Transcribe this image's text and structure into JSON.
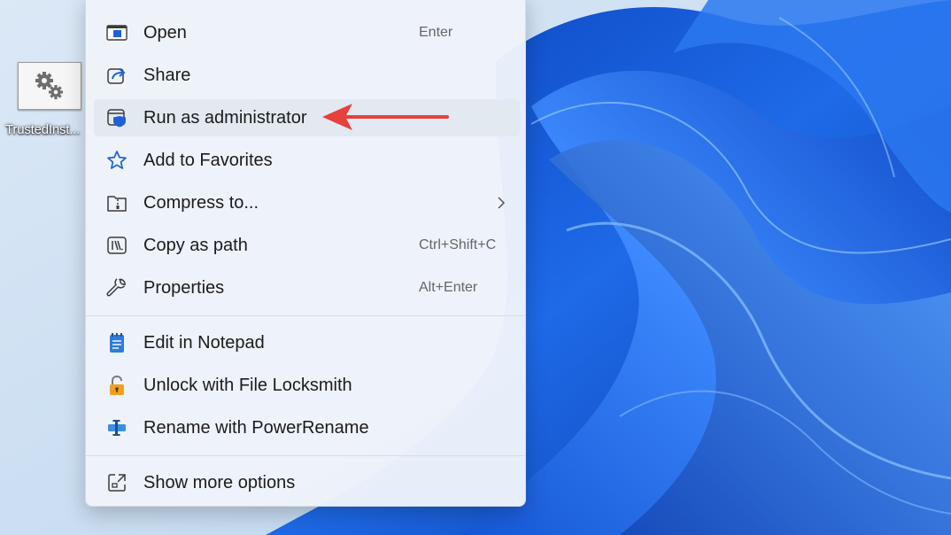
{
  "desktop": {
    "icon": {
      "name": "gear-file-icon",
      "label": "TrustedInst..."
    }
  },
  "context_menu": {
    "items": [
      {
        "label": "Open",
        "shortcut": "Enter",
        "icon": "open-window-icon"
      },
      {
        "label": "Share",
        "shortcut": "",
        "icon": "share-icon"
      },
      {
        "label": "Run as administrator",
        "shortcut": "",
        "icon": "shield-window-icon"
      },
      {
        "label": "Add to Favorites",
        "shortcut": "",
        "icon": "star-icon"
      },
      {
        "label": "Compress to...",
        "shortcut": "",
        "icon": "zip-folder-icon"
      },
      {
        "label": "Copy as path",
        "shortcut": "Ctrl+Shift+C",
        "icon": "copy-path-icon"
      },
      {
        "label": "Properties",
        "shortcut": "Alt+Enter",
        "icon": "wrench-icon"
      },
      {
        "label": "Edit in Notepad",
        "shortcut": "",
        "icon": "notepad-icon"
      },
      {
        "label": "Unlock with File Locksmith",
        "shortcut": "",
        "icon": "lock-icon"
      },
      {
        "label": "Rename with PowerRename",
        "shortcut": "",
        "icon": "power-rename-icon"
      },
      {
        "label": "Show more options",
        "shortcut": "",
        "icon": "show-more-icon"
      }
    ],
    "highlighted_item": "Run as administrator"
  },
  "annotation": {
    "type": "arrow",
    "color": "#e8403a",
    "points_to": "Run as administrator"
  },
  "colors": {
    "accent_blue": "#1e62d6",
    "menu_background": "#eef3fa",
    "arrow_red": "#e8403a"
  }
}
